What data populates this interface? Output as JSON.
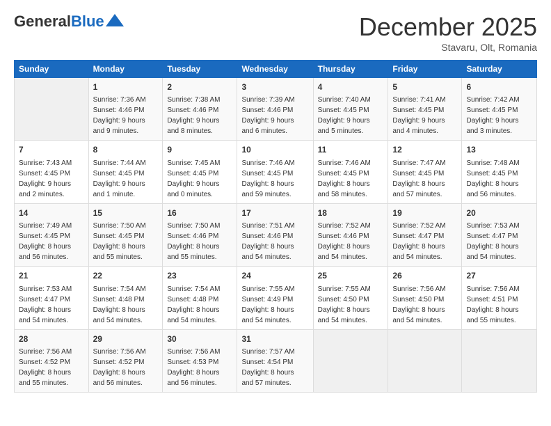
{
  "header": {
    "logo_general": "General",
    "logo_blue": "Blue",
    "title": "December 2025",
    "location": "Stavaru, Olt, Romania"
  },
  "days_of_week": [
    "Sunday",
    "Monday",
    "Tuesday",
    "Wednesday",
    "Thursday",
    "Friday",
    "Saturday"
  ],
  "weeks": [
    [
      {
        "day": "",
        "info": ""
      },
      {
        "day": "1",
        "info": "Sunrise: 7:36 AM\nSunset: 4:46 PM\nDaylight: 9 hours\nand 9 minutes."
      },
      {
        "day": "2",
        "info": "Sunrise: 7:38 AM\nSunset: 4:46 PM\nDaylight: 9 hours\nand 8 minutes."
      },
      {
        "day": "3",
        "info": "Sunrise: 7:39 AM\nSunset: 4:46 PM\nDaylight: 9 hours\nand 6 minutes."
      },
      {
        "day": "4",
        "info": "Sunrise: 7:40 AM\nSunset: 4:45 PM\nDaylight: 9 hours\nand 5 minutes."
      },
      {
        "day": "5",
        "info": "Sunrise: 7:41 AM\nSunset: 4:45 PM\nDaylight: 9 hours\nand 4 minutes."
      },
      {
        "day": "6",
        "info": "Sunrise: 7:42 AM\nSunset: 4:45 PM\nDaylight: 9 hours\nand 3 minutes."
      }
    ],
    [
      {
        "day": "7",
        "info": "Sunrise: 7:43 AM\nSunset: 4:45 PM\nDaylight: 9 hours\nand 2 minutes."
      },
      {
        "day": "8",
        "info": "Sunrise: 7:44 AM\nSunset: 4:45 PM\nDaylight: 9 hours\nand 1 minute."
      },
      {
        "day": "9",
        "info": "Sunrise: 7:45 AM\nSunset: 4:45 PM\nDaylight: 9 hours\nand 0 minutes."
      },
      {
        "day": "10",
        "info": "Sunrise: 7:46 AM\nSunset: 4:45 PM\nDaylight: 8 hours\nand 59 minutes."
      },
      {
        "day": "11",
        "info": "Sunrise: 7:46 AM\nSunset: 4:45 PM\nDaylight: 8 hours\nand 58 minutes."
      },
      {
        "day": "12",
        "info": "Sunrise: 7:47 AM\nSunset: 4:45 PM\nDaylight: 8 hours\nand 57 minutes."
      },
      {
        "day": "13",
        "info": "Sunrise: 7:48 AM\nSunset: 4:45 PM\nDaylight: 8 hours\nand 56 minutes."
      }
    ],
    [
      {
        "day": "14",
        "info": "Sunrise: 7:49 AM\nSunset: 4:45 PM\nDaylight: 8 hours\nand 56 minutes."
      },
      {
        "day": "15",
        "info": "Sunrise: 7:50 AM\nSunset: 4:45 PM\nDaylight: 8 hours\nand 55 minutes."
      },
      {
        "day": "16",
        "info": "Sunrise: 7:50 AM\nSunset: 4:46 PM\nDaylight: 8 hours\nand 55 minutes."
      },
      {
        "day": "17",
        "info": "Sunrise: 7:51 AM\nSunset: 4:46 PM\nDaylight: 8 hours\nand 54 minutes."
      },
      {
        "day": "18",
        "info": "Sunrise: 7:52 AM\nSunset: 4:46 PM\nDaylight: 8 hours\nand 54 minutes."
      },
      {
        "day": "19",
        "info": "Sunrise: 7:52 AM\nSunset: 4:47 PM\nDaylight: 8 hours\nand 54 minutes."
      },
      {
        "day": "20",
        "info": "Sunrise: 7:53 AM\nSunset: 4:47 PM\nDaylight: 8 hours\nand 54 minutes."
      }
    ],
    [
      {
        "day": "21",
        "info": "Sunrise: 7:53 AM\nSunset: 4:47 PM\nDaylight: 8 hours\nand 54 minutes."
      },
      {
        "day": "22",
        "info": "Sunrise: 7:54 AM\nSunset: 4:48 PM\nDaylight: 8 hours\nand 54 minutes."
      },
      {
        "day": "23",
        "info": "Sunrise: 7:54 AM\nSunset: 4:48 PM\nDaylight: 8 hours\nand 54 minutes."
      },
      {
        "day": "24",
        "info": "Sunrise: 7:55 AM\nSunset: 4:49 PM\nDaylight: 8 hours\nand 54 minutes."
      },
      {
        "day": "25",
        "info": "Sunrise: 7:55 AM\nSunset: 4:50 PM\nDaylight: 8 hours\nand 54 minutes."
      },
      {
        "day": "26",
        "info": "Sunrise: 7:56 AM\nSunset: 4:50 PM\nDaylight: 8 hours\nand 54 minutes."
      },
      {
        "day": "27",
        "info": "Sunrise: 7:56 AM\nSunset: 4:51 PM\nDaylight: 8 hours\nand 55 minutes."
      }
    ],
    [
      {
        "day": "28",
        "info": "Sunrise: 7:56 AM\nSunset: 4:52 PM\nDaylight: 8 hours\nand 55 minutes."
      },
      {
        "day": "29",
        "info": "Sunrise: 7:56 AM\nSunset: 4:52 PM\nDaylight: 8 hours\nand 56 minutes."
      },
      {
        "day": "30",
        "info": "Sunrise: 7:56 AM\nSunset: 4:53 PM\nDaylight: 8 hours\nand 56 minutes."
      },
      {
        "day": "31",
        "info": "Sunrise: 7:57 AM\nSunset: 4:54 PM\nDaylight: 8 hours\nand 57 minutes."
      },
      {
        "day": "",
        "info": ""
      },
      {
        "day": "",
        "info": ""
      },
      {
        "day": "",
        "info": ""
      }
    ]
  ]
}
